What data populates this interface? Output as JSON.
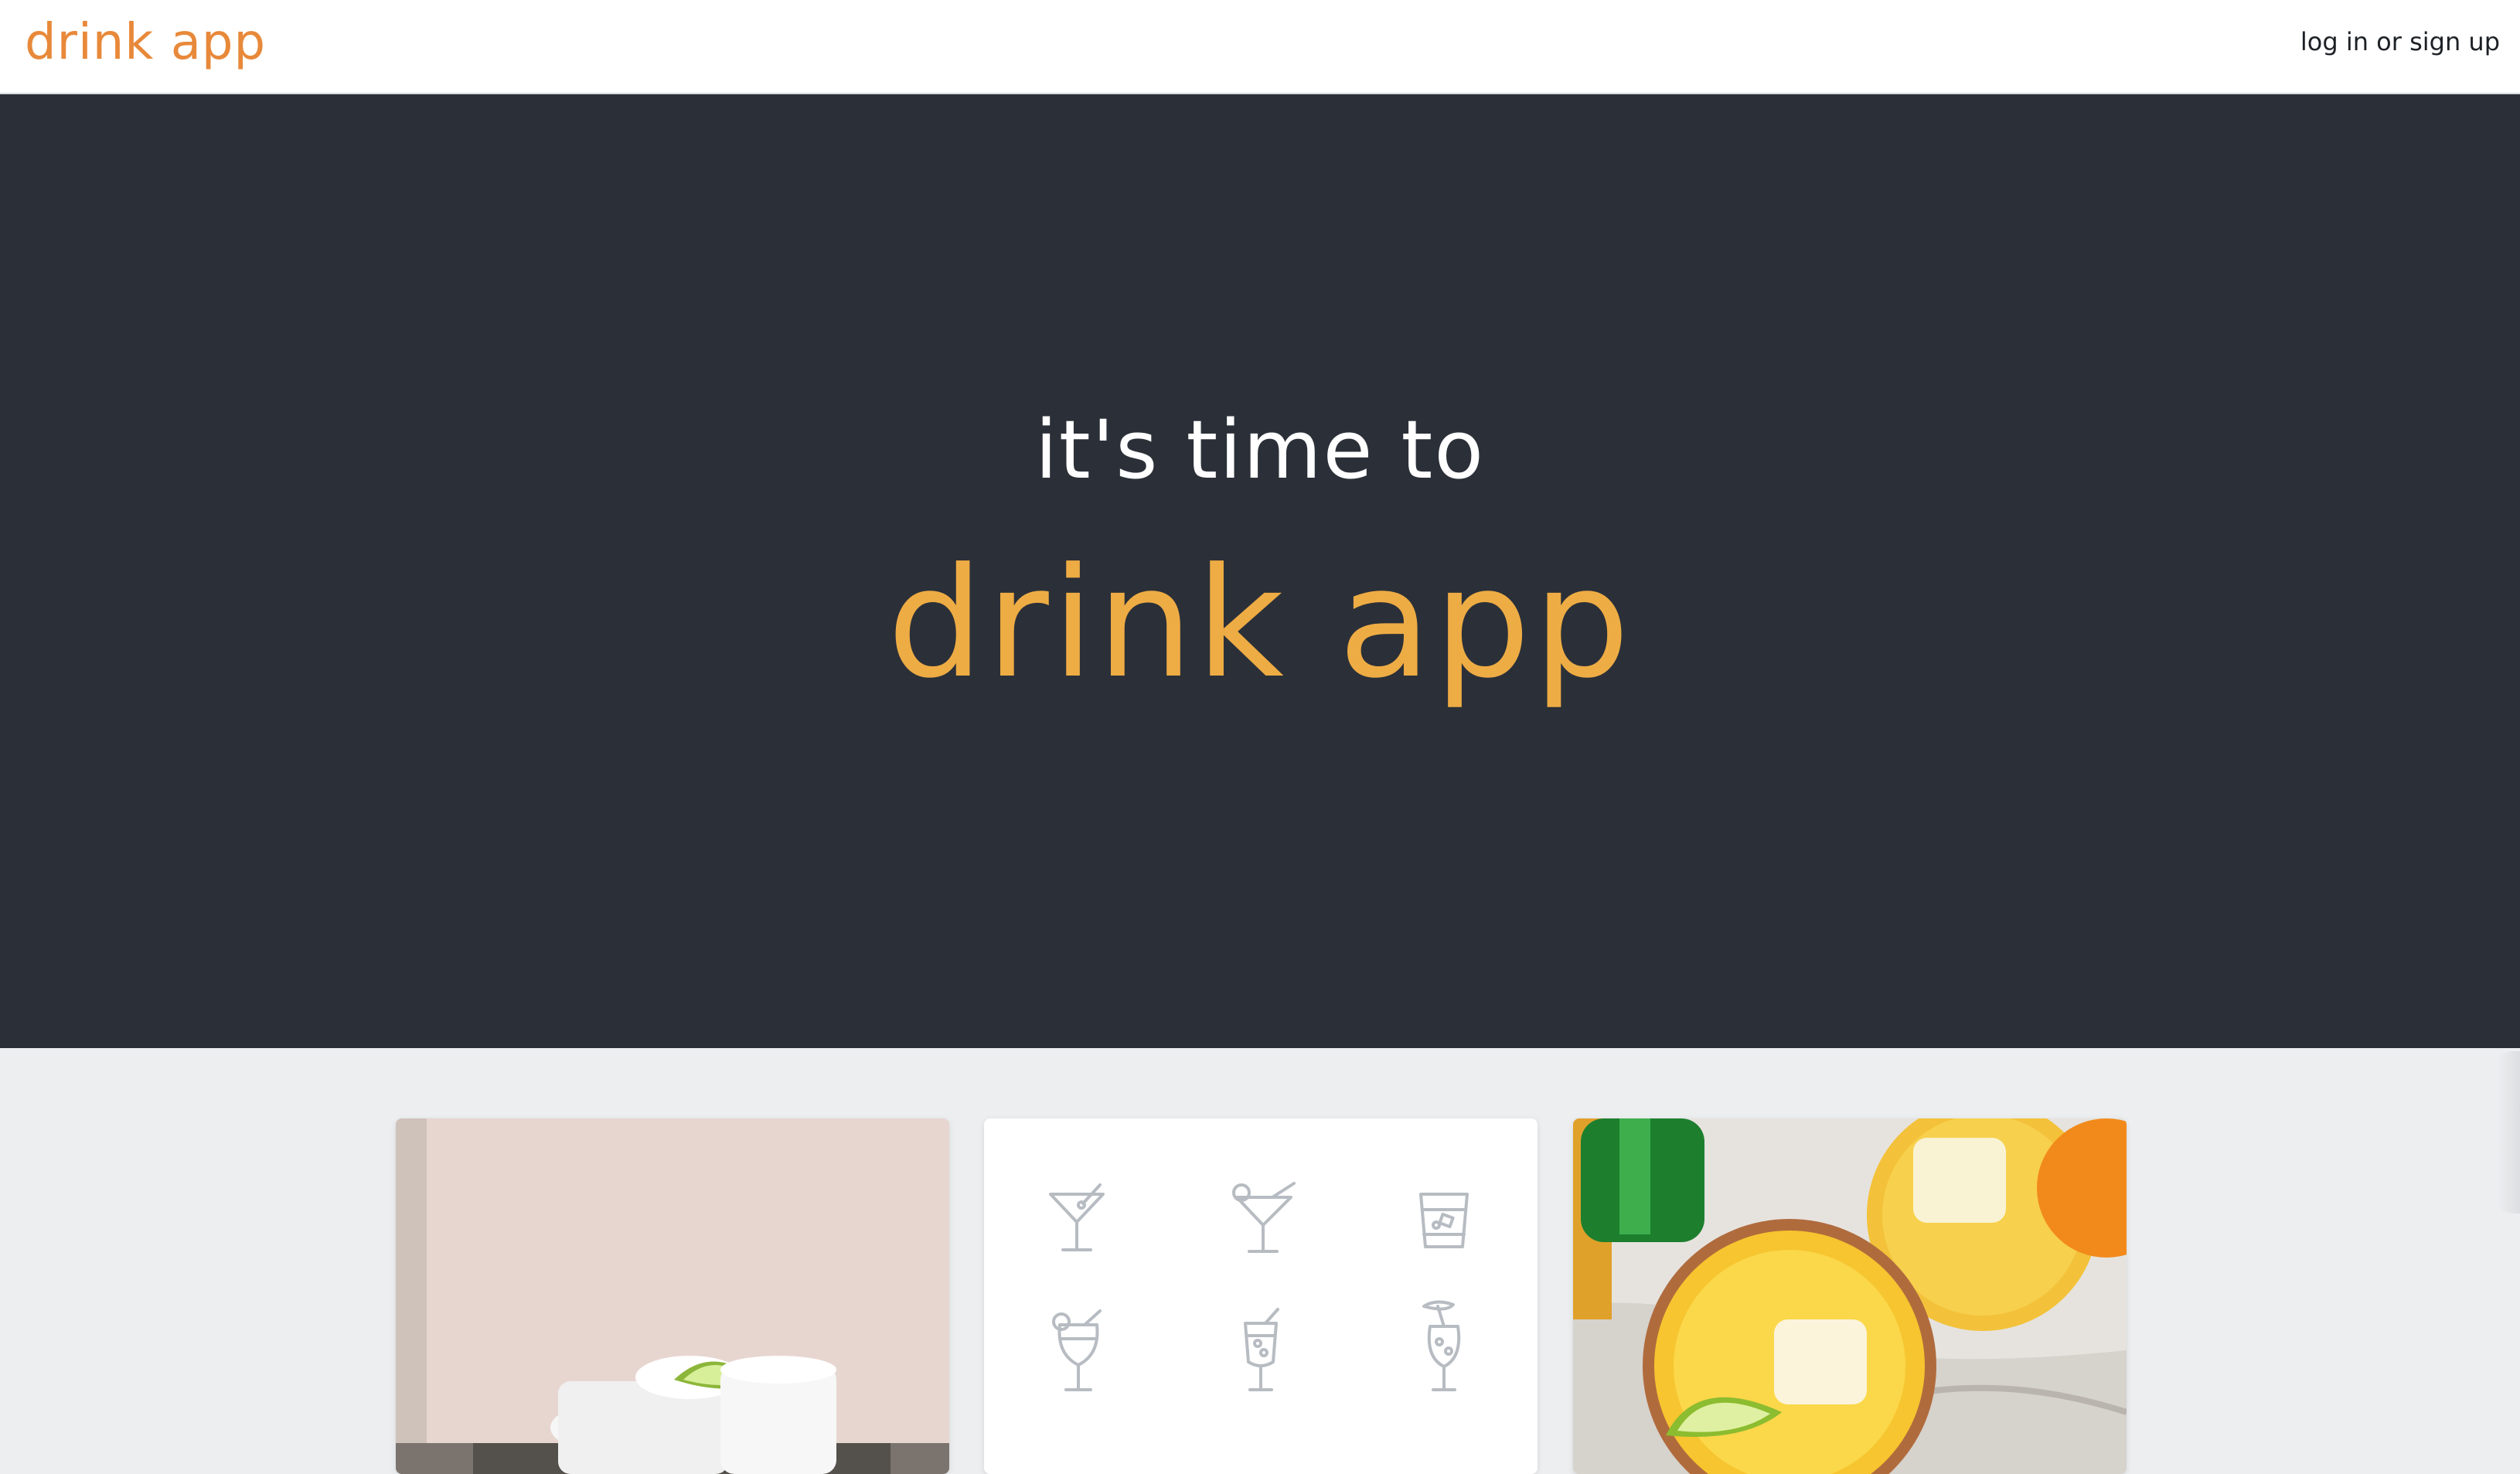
{
  "header": {
    "brand": "drink app",
    "login_label": "log in or sign up"
  },
  "hero": {
    "subtitle": "it's time to",
    "title": "drink app"
  },
  "cards": {
    "icon_names": [
      "martini-glass-icon",
      "cocktail-glass-icon",
      "rocks-glass-icon",
      "hurricane-glass-icon",
      "highball-glass-icon",
      "tiki-glass-icon"
    ]
  },
  "colors": {
    "brand": "#e8893a",
    "hero_bg": "#2b3038",
    "hero_title": "#eeac44",
    "page_bg": "#eceef0",
    "icon_stroke": "#b7bcc2"
  }
}
